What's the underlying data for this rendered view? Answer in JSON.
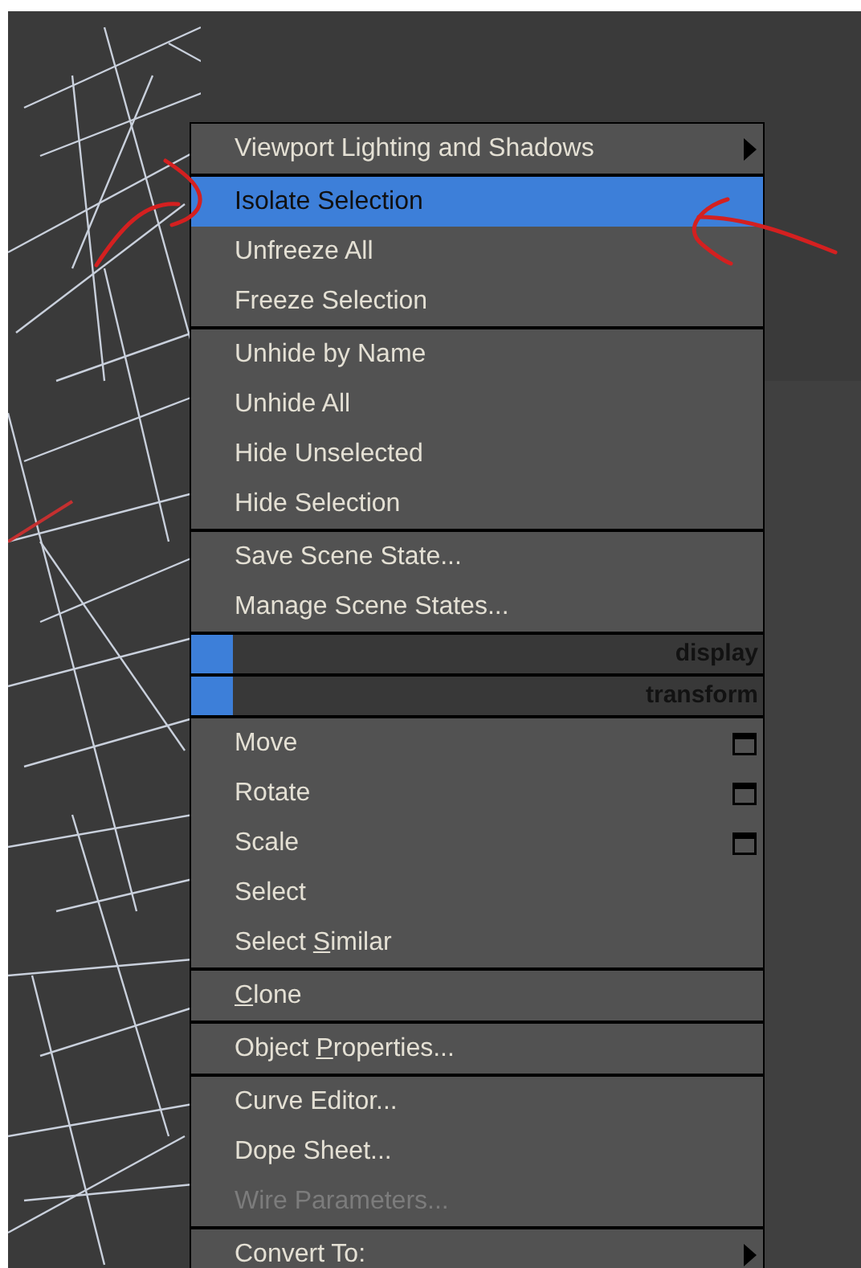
{
  "menu": {
    "sections": [
      {
        "kind": "items",
        "items": [
          {
            "label": "Viewport Lighting and Shadows",
            "selected": false,
            "disabled": false,
            "submenu": true,
            "option_box": false
          }
        ]
      },
      {
        "kind": "items",
        "items": [
          {
            "label": "Isolate Selection",
            "selected": true,
            "disabled": false,
            "submenu": false,
            "option_box": false
          },
          {
            "label": "Unfreeze All",
            "selected": false,
            "disabled": false,
            "submenu": false,
            "option_box": false
          },
          {
            "label": "Freeze Selection",
            "selected": false,
            "disabled": false,
            "submenu": false,
            "option_box": false
          }
        ]
      },
      {
        "kind": "items",
        "items": [
          {
            "label": "Unhide by Name",
            "selected": false,
            "disabled": false,
            "submenu": false,
            "option_box": false
          },
          {
            "label": "Unhide All",
            "selected": false,
            "disabled": false,
            "submenu": false,
            "option_box": false
          },
          {
            "label": "Hide Unselected",
            "selected": false,
            "disabled": false,
            "submenu": false,
            "option_box": false
          },
          {
            "label": "Hide Selection",
            "selected": false,
            "disabled": false,
            "submenu": false,
            "option_box": false
          }
        ]
      },
      {
        "kind": "items",
        "items": [
          {
            "label": "Save Scene State...",
            "selected": false,
            "disabled": false,
            "submenu": false,
            "option_box": false
          },
          {
            "label": "Manage Scene States...",
            "selected": false,
            "disabled": false,
            "submenu": false,
            "option_box": false
          }
        ]
      },
      {
        "kind": "header",
        "title": "display"
      },
      {
        "kind": "header",
        "title": "transform"
      },
      {
        "kind": "items",
        "items": [
          {
            "label": "Move",
            "selected": false,
            "disabled": false,
            "submenu": false,
            "option_box": true
          },
          {
            "label": "Rotate",
            "selected": false,
            "disabled": false,
            "submenu": false,
            "option_box": true
          },
          {
            "label": "Scale",
            "selected": false,
            "disabled": false,
            "submenu": false,
            "option_box": true
          },
          {
            "label": "Select",
            "selected": false,
            "disabled": false,
            "submenu": false,
            "option_box": false
          },
          {
            "parts": [
              {
                "text": "Select ",
                "underlined": false
              },
              {
                "text": "S",
                "underlined": true
              },
              {
                "text": "imilar",
                "underlined": false
              }
            ],
            "selected": false,
            "disabled": false,
            "submenu": false,
            "option_box": false
          }
        ]
      },
      {
        "kind": "items",
        "items": [
          {
            "parts": [
              {
                "text": "C",
                "underlined": true
              },
              {
                "text": "lone",
                "underlined": false
              }
            ],
            "selected": false,
            "disabled": false,
            "submenu": false,
            "option_box": false
          }
        ]
      },
      {
        "kind": "items",
        "items": [
          {
            "parts": [
              {
                "text": "Object ",
                "underlined": false
              },
              {
                "text": "P",
                "underlined": true
              },
              {
                "text": "roperties...",
                "underlined": false
              }
            ],
            "selected": false,
            "disabled": false,
            "submenu": false,
            "option_box": false
          }
        ]
      },
      {
        "kind": "items",
        "items": [
          {
            "label": "Curve Editor...",
            "selected": false,
            "disabled": false,
            "submenu": false,
            "option_box": false
          },
          {
            "label": "Dope Sheet...",
            "selected": false,
            "disabled": false,
            "submenu": false,
            "option_box": false
          },
          {
            "label": "Wire Parameters...",
            "selected": false,
            "disabled": true,
            "submenu": false,
            "option_box": false
          }
        ]
      },
      {
        "kind": "items",
        "items": [
          {
            "label": "Convert To:",
            "selected": false,
            "disabled": false,
            "submenu": true,
            "option_box": false
          }
        ]
      }
    ]
  }
}
